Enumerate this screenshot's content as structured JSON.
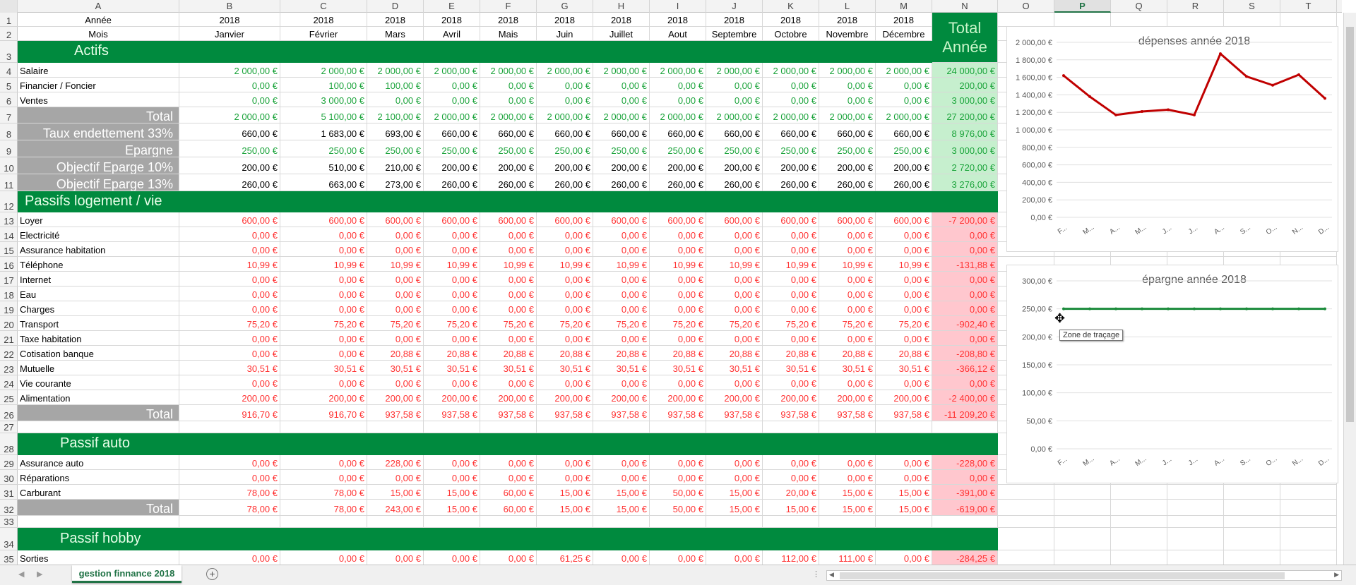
{
  "columns": [
    "A",
    "B",
    "C",
    "D",
    "E",
    "F",
    "G",
    "H",
    "I",
    "J",
    "K",
    "L",
    "M",
    "N",
    "O",
    "P",
    "Q",
    "R",
    "S",
    "T"
  ],
  "selected_column": "P",
  "rows": [
    {
      "n": "1",
      "type": "hdr",
      "cells": [
        "Année",
        "2018",
        "2018",
        "2018",
        "2018",
        "2018",
        "2018",
        "2018",
        "2018",
        "2018",
        "2018",
        "2018",
        "2018"
      ]
    },
    {
      "n": "2",
      "type": "hdr",
      "cells": [
        "Mois",
        "Janvier",
        "Février",
        "Mars",
        "Avril",
        "Mais",
        "Juin",
        "Juillet",
        "Aout",
        "Septembre",
        "Octobre",
        "Novembre",
        "Décembre"
      ]
    },
    {
      "n": "3",
      "type": "band",
      "label": "Actifs"
    },
    {
      "n": "4",
      "type": "data",
      "color": "green",
      "tot": "g",
      "cells": [
        "Salaire",
        "2 000,00 €",
        "2 000,00 €",
        "2 000,00 €",
        "2 000,00 €",
        "2 000,00 €",
        "2 000,00 €",
        "2 000,00 €",
        "2 000,00 €",
        "2 000,00 €",
        "2 000,00 €",
        "2 000,00 €",
        "2 000,00 €",
        "24 000,00 €"
      ]
    },
    {
      "n": "5",
      "type": "data",
      "color": "green",
      "tot": "g",
      "cells": [
        "Financier / Foncier",
        "0,00 €",
        "100,00 €",
        "100,00 €",
        "0,00 €",
        "0,00 €",
        "0,00 €",
        "0,00 €",
        "0,00 €",
        "0,00 €",
        "0,00 €",
        "0,00 €",
        "0,00 €",
        "200,00 €"
      ]
    },
    {
      "n": "6",
      "type": "data",
      "color": "green",
      "tot": "g",
      "cells": [
        "Ventes",
        "0,00 €",
        "3 000,00 €",
        "0,00 €",
        "0,00 €",
        "0,00 €",
        "0,00 €",
        "0,00 €",
        "0,00 €",
        "0,00 €",
        "0,00 €",
        "0,00 €",
        "0,00 €",
        "3 000,00 €"
      ]
    },
    {
      "n": "7",
      "type": "graydata",
      "color": "green",
      "tot": "g",
      "cells": [
        "Total",
        "2 000,00 €",
        "5 100,00 €",
        "2 100,00 €",
        "2 000,00 €",
        "2 000,00 €",
        "2 000,00 €",
        "2 000,00 €",
        "2 000,00 €",
        "2 000,00 €",
        "2 000,00 €",
        "2 000,00 €",
        "2 000,00 €",
        "27 200,00 €"
      ]
    },
    {
      "n": "8",
      "type": "graydata",
      "color": "blk",
      "tot": "g",
      "cells": [
        "Taux endettement 33%",
        "660,00 €",
        "1 683,00 €",
        "693,00 €",
        "660,00 €",
        "660,00 €",
        "660,00 €",
        "660,00 €",
        "660,00 €",
        "660,00 €",
        "660,00 €",
        "660,00 €",
        "660,00 €",
        "8 976,00 €"
      ]
    },
    {
      "n": "9",
      "type": "graydata",
      "color": "green",
      "tot": "g",
      "cells": [
        "Epargne",
        "250,00 €",
        "250,00 €",
        "250,00 €",
        "250,00 €",
        "250,00 €",
        "250,00 €",
        "250,00 €",
        "250,00 €",
        "250,00 €",
        "250,00 €",
        "250,00 €",
        "250,00 €",
        "3 000,00 €"
      ]
    },
    {
      "n": "10",
      "type": "graydata",
      "color": "blk",
      "tot": "g",
      "cells": [
        "Objectif Eparge 10%",
        "200,00 €",
        "510,00 €",
        "210,00 €",
        "200,00 €",
        "200,00 €",
        "200,00 €",
        "200,00 €",
        "200,00 €",
        "200,00 €",
        "200,00 €",
        "200,00 €",
        "200,00 €",
        "2 720,00 €"
      ]
    },
    {
      "n": "11",
      "type": "graydata",
      "color": "blk",
      "tot": "g",
      "cells": [
        "Objectif Eparge 13%",
        "260,00 €",
        "663,00 €",
        "273,00 €",
        "260,00 €",
        "260,00 €",
        "260,00 €",
        "260,00 €",
        "260,00 €",
        "260,00 €",
        "260,00 €",
        "260,00 €",
        "260,00 €",
        "3 276,00 €"
      ]
    },
    {
      "n": "12",
      "type": "band",
      "label": "Passifs logement / vie"
    },
    {
      "n": "13",
      "type": "data",
      "color": "red",
      "tot": "r",
      "cells": [
        "Loyer",
        "600,00 €",
        "600,00 €",
        "600,00 €",
        "600,00 €",
        "600,00 €",
        "600,00 €",
        "600,00 €",
        "600,00 €",
        "600,00 €",
        "600,00 €",
        "600,00 €",
        "600,00 €",
        "-7 200,00 €"
      ]
    },
    {
      "n": "14",
      "type": "data",
      "color": "red",
      "tot": "r",
      "cells": [
        "Electricité",
        "0,00 €",
        "0,00 €",
        "0,00 €",
        "0,00 €",
        "0,00 €",
        "0,00 €",
        "0,00 €",
        "0,00 €",
        "0,00 €",
        "0,00 €",
        "0,00 €",
        "0,00 €",
        "0,00 €"
      ]
    },
    {
      "n": "15",
      "type": "data",
      "color": "red",
      "tot": "r",
      "cells": [
        "Assurance habitation",
        "0,00 €",
        "0,00 €",
        "0,00 €",
        "0,00 €",
        "0,00 €",
        "0,00 €",
        "0,00 €",
        "0,00 €",
        "0,00 €",
        "0,00 €",
        "0,00 €",
        "0,00 €",
        "0,00 €"
      ]
    },
    {
      "n": "16",
      "type": "data",
      "color": "red",
      "tot": "r",
      "cells": [
        "Téléphone",
        "10,99 €",
        "10,99 €",
        "10,99 €",
        "10,99 €",
        "10,99 €",
        "10,99 €",
        "10,99 €",
        "10,99 €",
        "10,99 €",
        "10,99 €",
        "10,99 €",
        "10,99 €",
        "-131,88 €"
      ]
    },
    {
      "n": "17",
      "type": "data",
      "color": "red",
      "tot": "r",
      "cells": [
        "Internet",
        "0,00 €",
        "0,00 €",
        "0,00 €",
        "0,00 €",
        "0,00 €",
        "0,00 €",
        "0,00 €",
        "0,00 €",
        "0,00 €",
        "0,00 €",
        "0,00 €",
        "0,00 €",
        "0,00 €"
      ]
    },
    {
      "n": "18",
      "type": "data",
      "color": "red",
      "tot": "r",
      "cells": [
        "Eau",
        "0,00 €",
        "0,00 €",
        "0,00 €",
        "0,00 €",
        "0,00 €",
        "0,00 €",
        "0,00 €",
        "0,00 €",
        "0,00 €",
        "0,00 €",
        "0,00 €",
        "0,00 €",
        "0,00 €"
      ]
    },
    {
      "n": "19",
      "type": "data",
      "color": "red",
      "tot": "r",
      "cells": [
        "Charges",
        "0,00 €",
        "0,00 €",
        "0,00 €",
        "0,00 €",
        "0,00 €",
        "0,00 €",
        "0,00 €",
        "0,00 €",
        "0,00 €",
        "0,00 €",
        "0,00 €",
        "0,00 €",
        "0,00 €"
      ]
    },
    {
      "n": "20",
      "type": "data",
      "color": "red",
      "tot": "r",
      "cells": [
        "Transport",
        "75,20 €",
        "75,20 €",
        "75,20 €",
        "75,20 €",
        "75,20 €",
        "75,20 €",
        "75,20 €",
        "75,20 €",
        "75,20 €",
        "75,20 €",
        "75,20 €",
        "75,20 €",
        "-902,40 €"
      ]
    },
    {
      "n": "21",
      "type": "data",
      "color": "red",
      "tot": "r",
      "cells": [
        "Taxe habitation",
        "0,00 €",
        "0,00 €",
        "0,00 €",
        "0,00 €",
        "0,00 €",
        "0,00 €",
        "0,00 €",
        "0,00 €",
        "0,00 €",
        "0,00 €",
        "0,00 €",
        "0,00 €",
        "0,00 €"
      ]
    },
    {
      "n": "22",
      "type": "data",
      "color": "red",
      "tot": "r",
      "cells": [
        "Cotisation banque",
        "0,00 €",
        "0,00 €",
        "20,88 €",
        "20,88 €",
        "20,88 €",
        "20,88 €",
        "20,88 €",
        "20,88 €",
        "20,88 €",
        "20,88 €",
        "20,88 €",
        "20,88 €",
        "-208,80 €"
      ]
    },
    {
      "n": "23",
      "type": "data",
      "color": "red",
      "tot": "r",
      "cells": [
        "Mutuelle",
        "30,51 €",
        "30,51 €",
        "30,51 €",
        "30,51 €",
        "30,51 €",
        "30,51 €",
        "30,51 €",
        "30,51 €",
        "30,51 €",
        "30,51 €",
        "30,51 €",
        "30,51 €",
        "-366,12 €"
      ]
    },
    {
      "n": "24",
      "type": "data",
      "color": "red",
      "tot": "r",
      "cells": [
        "Vie courante",
        "0,00 €",
        "0,00 €",
        "0,00 €",
        "0,00 €",
        "0,00 €",
        "0,00 €",
        "0,00 €",
        "0,00 €",
        "0,00 €",
        "0,00 €",
        "0,00 €",
        "0,00 €",
        "0,00 €"
      ]
    },
    {
      "n": "25",
      "type": "data",
      "color": "red",
      "tot": "r",
      "cells": [
        "Alimentation",
        "200,00 €",
        "200,00 €",
        "200,00 €",
        "200,00 €",
        "200,00 €",
        "200,00 €",
        "200,00 €",
        "200,00 €",
        "200,00 €",
        "200,00 €",
        "200,00 €",
        "200,00 €",
        "-2 400,00 €"
      ]
    },
    {
      "n": "26",
      "type": "graydata",
      "color": "red",
      "tot": "r",
      "cells": [
        "Total",
        "916,70 €",
        "916,70 €",
        "937,58 €",
        "937,58 €",
        "937,58 €",
        "937,58 €",
        "937,58 €",
        "937,58 €",
        "937,58 €",
        "937,58 €",
        "937,58 €",
        "937,58 €",
        "-11 209,20 €"
      ]
    },
    {
      "n": "27",
      "type": "empty"
    },
    {
      "n": "28",
      "type": "band",
      "label": "Passif auto"
    },
    {
      "n": "29",
      "type": "data",
      "color": "red",
      "tot": "r",
      "cells": [
        "Assurance auto",
        "0,00 €",
        "0,00 €",
        "228,00 €",
        "0,00 €",
        "0,00 €",
        "0,00 €",
        "0,00 €",
        "0,00 €",
        "0,00 €",
        "0,00 €",
        "0,00 €",
        "0,00 €",
        "-228,00 €"
      ]
    },
    {
      "n": "30",
      "type": "data",
      "color": "red",
      "tot": "r",
      "cells": [
        "Réparations",
        "0,00 €",
        "0,00 €",
        "0,00 €",
        "0,00 €",
        "0,00 €",
        "0,00 €",
        "0,00 €",
        "0,00 €",
        "0,00 €",
        "0,00 €",
        "0,00 €",
        "0,00 €",
        "0,00 €"
      ]
    },
    {
      "n": "31",
      "type": "data",
      "color": "red",
      "tot": "r",
      "cells": [
        "Carburant",
        "78,00 €",
        "78,00 €",
        "15,00 €",
        "15,00 €",
        "60,00 €",
        "15,00 €",
        "15,00 €",
        "50,00 €",
        "15,00 €",
        "20,00 €",
        "15,00 €",
        "15,00 €",
        "-391,00 €"
      ]
    },
    {
      "n": "32",
      "type": "graydata",
      "color": "red",
      "tot": "r",
      "cells": [
        "Total",
        "78,00 €",
        "78,00 €",
        "243,00 €",
        "15,00 €",
        "60,00 €",
        "15,00 €",
        "15,00 €",
        "50,00 €",
        "15,00 €",
        "15,00 €",
        "15,00 €",
        "15,00 €",
        "-619,00 €"
      ]
    },
    {
      "n": "33",
      "type": "empty"
    },
    {
      "n": "34",
      "type": "band",
      "label": "Passif hobby"
    },
    {
      "n": "35",
      "type": "data",
      "color": "red",
      "tot": "r",
      "cells": [
        "Sorties",
        "0,00 €",
        "0,00 €",
        "0,00 €",
        "0,00 €",
        "0,00 €",
        "61,25 €",
        "0,00 €",
        "0,00 €",
        "0,00 €",
        "112,00 €",
        "111,00 €",
        "0,00 €",
        "-284,25 €"
      ]
    }
  ],
  "total_header": {
    "line1": "Total",
    "line2": "Année"
  },
  "chart_data": [
    {
      "type": "line",
      "title": "dépenses année 2018",
      "categories": [
        "F...",
        "M...",
        "A...",
        "M...",
        "J...",
        "J...",
        "A...",
        "S...",
        "O...",
        "N...",
        "D..."
      ],
      "values": [
        1620,
        1380,
        1170,
        1210,
        1230,
        1170,
        1870,
        1610,
        1510,
        1630,
        1360
      ],
      "ylim": [
        0,
        2000
      ],
      "yticks": [
        "0,00 €",
        "200,00 €",
        "400,00 €",
        "600,00 €",
        "800,00 €",
        "1 000,00 €",
        "1 200,00 €",
        "1 400,00 €",
        "1 600,00 €",
        "1 800,00 €",
        "2 000,00 €"
      ],
      "color": "#c00000"
    },
    {
      "type": "line",
      "title": "épargne année 2018",
      "categories": [
        "F...",
        "M...",
        "A...",
        "M...",
        "J...",
        "J...",
        "A...",
        "S...",
        "O...",
        "N...",
        "D..."
      ],
      "values": [
        250,
        250,
        250,
        250,
        250,
        250,
        250,
        250,
        250,
        250,
        250
      ],
      "ylim": [
        0,
        300
      ],
      "yticks": [
        "0,00 €",
        "50,00 €",
        "100,00 €",
        "150,00 €",
        "200,00 €",
        "250,00 €",
        "300,00 €"
      ],
      "color": "#1a8a3a"
    }
  ],
  "tooltip": "Zone de traçage",
  "sheet_tab": "gestion finnance 2018"
}
